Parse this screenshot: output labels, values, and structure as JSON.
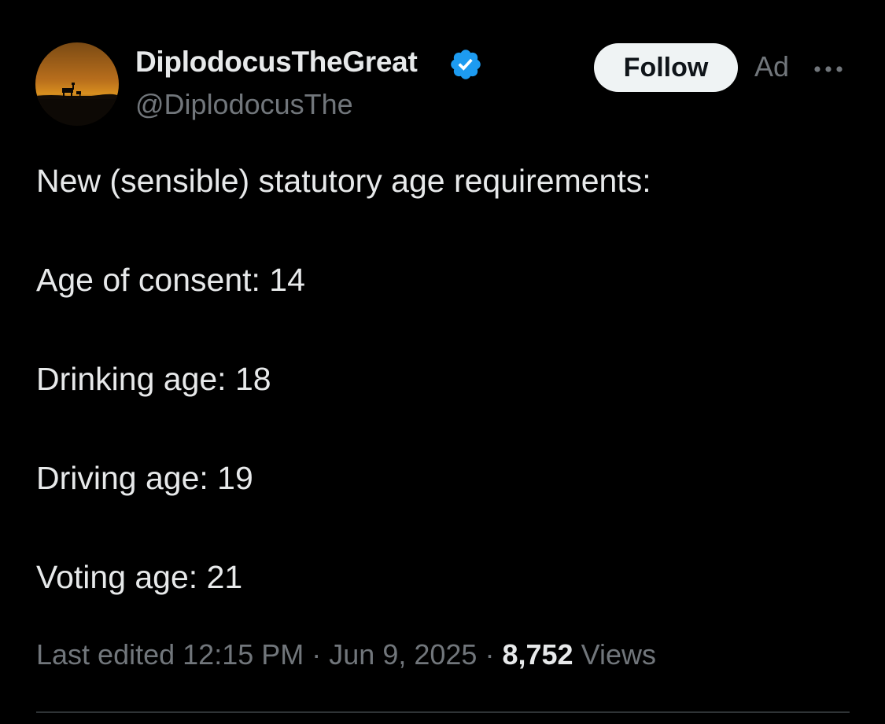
{
  "author": {
    "display_name": "DiplodocusTheGreat",
    "handle": "@DiplodocusThe",
    "verified": true,
    "avatar_icon": "sunset-silhouette-avatar"
  },
  "actions": {
    "follow_label": "Follow",
    "ad_label": "Ad",
    "more_icon": "more-dots-icon"
  },
  "tweet": {
    "lines": [
      "New (sensible) statutory age requirements:",
      "Age of consent: 14",
      "Drinking age: 18",
      "Driving age: 19",
      "Voting age: 21"
    ]
  },
  "meta": {
    "edited_prefix": "Last edited",
    "time": "12:15 PM",
    "separator": "·",
    "date": "Jun 9, 2025",
    "views_count": "8,752",
    "views_label": "Views"
  },
  "colors": {
    "background": "#000000",
    "primary_text": "#e7e9ea",
    "secondary_text": "#71767b",
    "verified_blue": "#1d9bf0",
    "follow_bg": "#eff3f4",
    "follow_text": "#0f1419",
    "divider": "#2f3336"
  }
}
